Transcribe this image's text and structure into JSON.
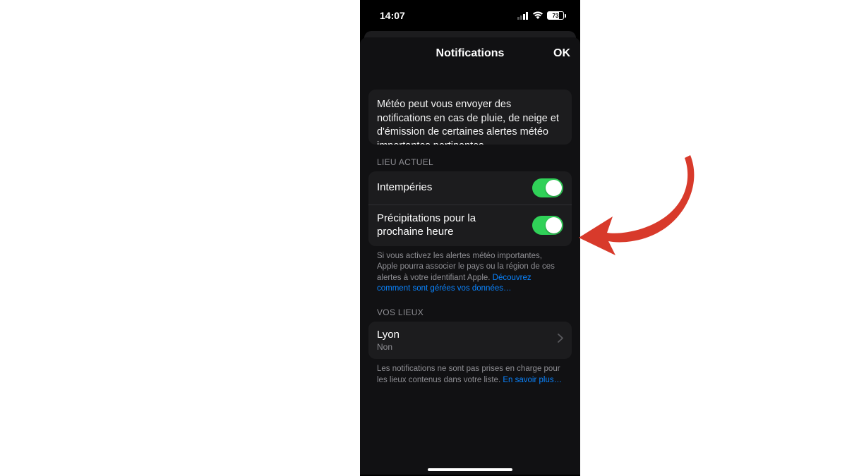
{
  "status": {
    "time": "14:07",
    "battery_percent": "73"
  },
  "nav": {
    "title": "Notifications",
    "done": "OK"
  },
  "intro": "Météo peut vous envoyer des notifications en cas de pluie, de neige et d'émission de certaines alertes météo importantes pertinentes.",
  "sections": {
    "current": {
      "header": "LIEU ACTUEL",
      "rows": [
        {
          "label": "Intempéries",
          "on": true
        },
        {
          "label": "Précipitations pour la prochaine heure",
          "on": true
        }
      ],
      "footer_text": "Si vous activez les alertes météo importantes, Apple pourra associer le pays ou la région de ces alertes à votre identifiant Apple. ",
      "footer_link": "Découvrez comment sont gérées vos données…"
    },
    "places": {
      "header": "VOS LIEUX",
      "rows": [
        {
          "label": "Lyon",
          "sub": "Non"
        }
      ],
      "footer_text": "Les notifications ne sont pas prises en charge pour les lieux contenus dans votre liste. ",
      "footer_link": "En savoir plus…"
    }
  },
  "annotation": {
    "arrow_color": "#d83a2b"
  }
}
